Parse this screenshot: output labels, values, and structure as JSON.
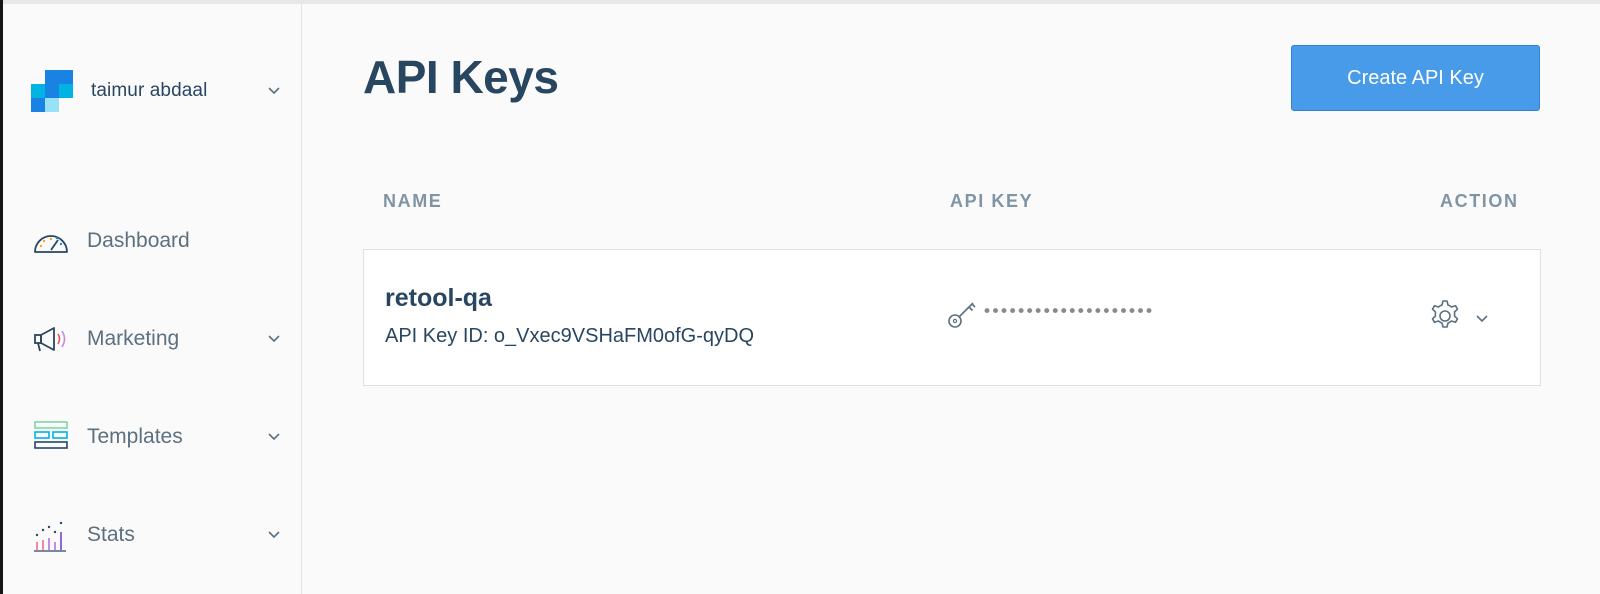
{
  "account": {
    "name": "taimur abdaal"
  },
  "sidebar": {
    "items": [
      {
        "label": "Dashboard",
        "icon": "gauge-icon"
      },
      {
        "label": "Marketing",
        "icon": "megaphone-icon"
      },
      {
        "label": "Templates",
        "icon": "template-icon"
      },
      {
        "label": "Stats",
        "icon": "stats-icon"
      }
    ]
  },
  "main": {
    "title": "API Keys",
    "create_button": "Create API Key",
    "columns": [
      "NAME",
      "API KEY",
      "ACTION"
    ],
    "keys": [
      {
        "name": "retool-qa",
        "id_text": "API Key ID: o_Vxec9VSHaFM0ofG-qyDQ",
        "masked_value": "••••••••••••••••••••"
      }
    ]
  },
  "colors": {
    "primary_button": "#489be8",
    "heading": "#294661",
    "muted": "#8094a4"
  }
}
